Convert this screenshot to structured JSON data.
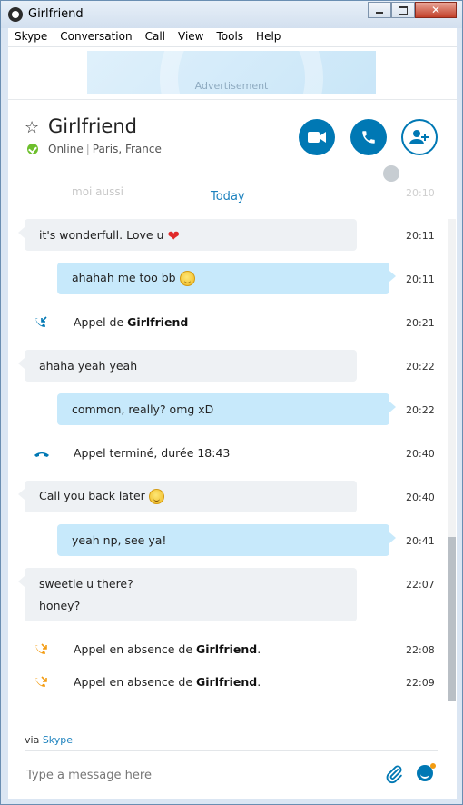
{
  "window": {
    "title": "Girlfriend"
  },
  "menu": [
    "Skype",
    "Conversation",
    "Call",
    "View",
    "Tools",
    "Help"
  ],
  "ad": {
    "label": "Advertisement"
  },
  "contact": {
    "name": "Girlfriend",
    "status": "Online",
    "location": "Paris, France"
  },
  "conversation": {
    "faded_message": "moi aussi",
    "faded_time": "20:10",
    "date_separator": "Today",
    "messages": [
      {
        "text": "it's wonderfull. Love u",
        "time": "20:11"
      },
      {
        "text": "ahahah me too bb",
        "time": "20:11"
      },
      {
        "text_prefix": "Appel de",
        "text_bold": "Girlfriend",
        "time": "20:21"
      },
      {
        "text": "ahaha yeah yeah",
        "time": "20:22"
      },
      {
        "text": "common, really? omg xD",
        "time": "20:22"
      },
      {
        "text": "Appel terminé, durée 18:43",
        "time": "20:40"
      },
      {
        "text": "Call you back later",
        "time": "20:40"
      },
      {
        "text": "yeah np, see ya!",
        "time": "20:41"
      },
      {
        "line1": "sweetie u there?",
        "line2": "honey?",
        "time": "22:07"
      },
      {
        "text_prefix": "Appel en absence de",
        "text_bold": "Girlfriend",
        "text_suffix": ".",
        "time": "22:08"
      },
      {
        "text_prefix": "Appel en absence de",
        "text_bold": "Girlfriend",
        "text_suffix": ".",
        "time": "22:09"
      }
    ]
  },
  "footer": {
    "via_prefix": "via",
    "via_link": "Skype",
    "placeholder": "Type a message here"
  },
  "colors": {
    "accent": "#0078b4",
    "outgoing_bubble": "#c7e9fb",
    "incoming_bubble": "#eef1f4",
    "missed_call": "#f39c12",
    "online": "#6dbf2c"
  }
}
